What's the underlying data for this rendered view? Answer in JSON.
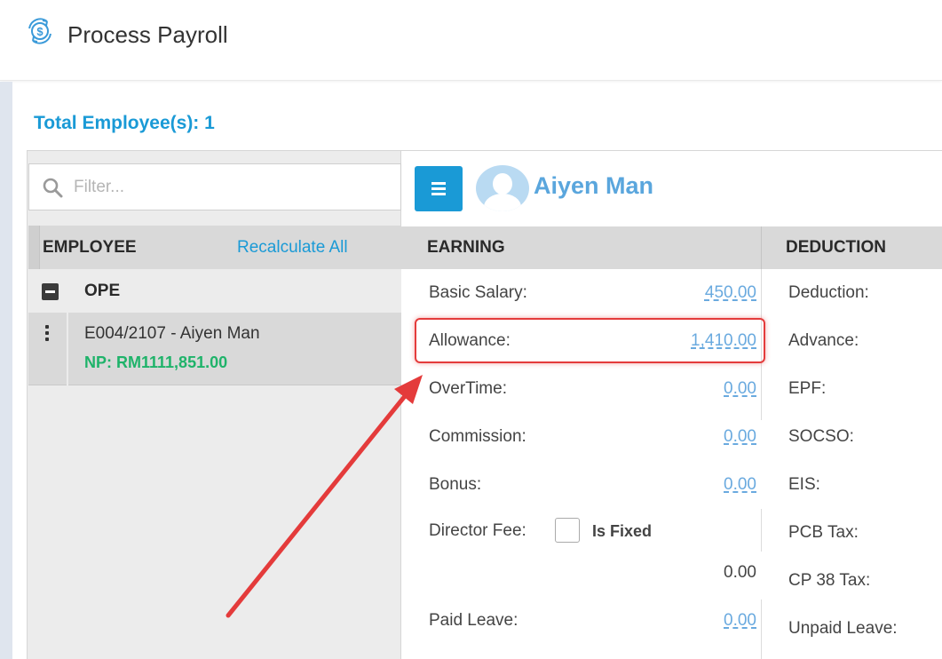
{
  "header": {
    "title": "Process Payroll",
    "icon": "payroll-cycle-icon"
  },
  "summary": {
    "total_label": "Total Employee(s): 1"
  },
  "employee_list": {
    "filter_placeholder": "Filter...",
    "column_label": "EMPLOYEE",
    "recalculate_label": "Recalculate All",
    "groups": [
      {
        "name": "OPE",
        "employees": [
          {
            "name": "E004/2107 - Aiyen Man",
            "net_pay": "NP: RM1111,851.00"
          }
        ]
      }
    ]
  },
  "detail": {
    "employee_name": "Aiyen Man",
    "earning_header": "EARNING",
    "deduction_header": "DEDUCTION",
    "earnings": [
      {
        "label": "Basic Salary:",
        "value": "450.00"
      },
      {
        "label": "Allowance:",
        "value": "1,410.00"
      },
      {
        "label": "OverTime:",
        "value": "0.00"
      },
      {
        "label": "Commission:",
        "value": "0.00"
      },
      {
        "label": "Bonus:",
        "value": "0.00"
      },
      {
        "label": "Director Fee:",
        "fixed_label": "Is Fixed",
        "fixed_checked": false,
        "value": "0.00"
      },
      {
        "label": "Paid Leave:",
        "value": "0.00"
      }
    ],
    "deductions": [
      {
        "label": "Deduction:"
      },
      {
        "label": "Advance:"
      },
      {
        "label": "EPF:"
      },
      {
        "label": "SOCSO:"
      },
      {
        "label": "EIS:"
      },
      {
        "label": "PCB Tax:"
      },
      {
        "label": "CP 38 Tax:"
      },
      {
        "label": "Unpaid Leave:"
      }
    ]
  },
  "colors": {
    "accent": "#1a9ad6",
    "net_pay": "#1fb36a",
    "link_value": "#6aaadf",
    "annotation": "#e43b3b"
  }
}
